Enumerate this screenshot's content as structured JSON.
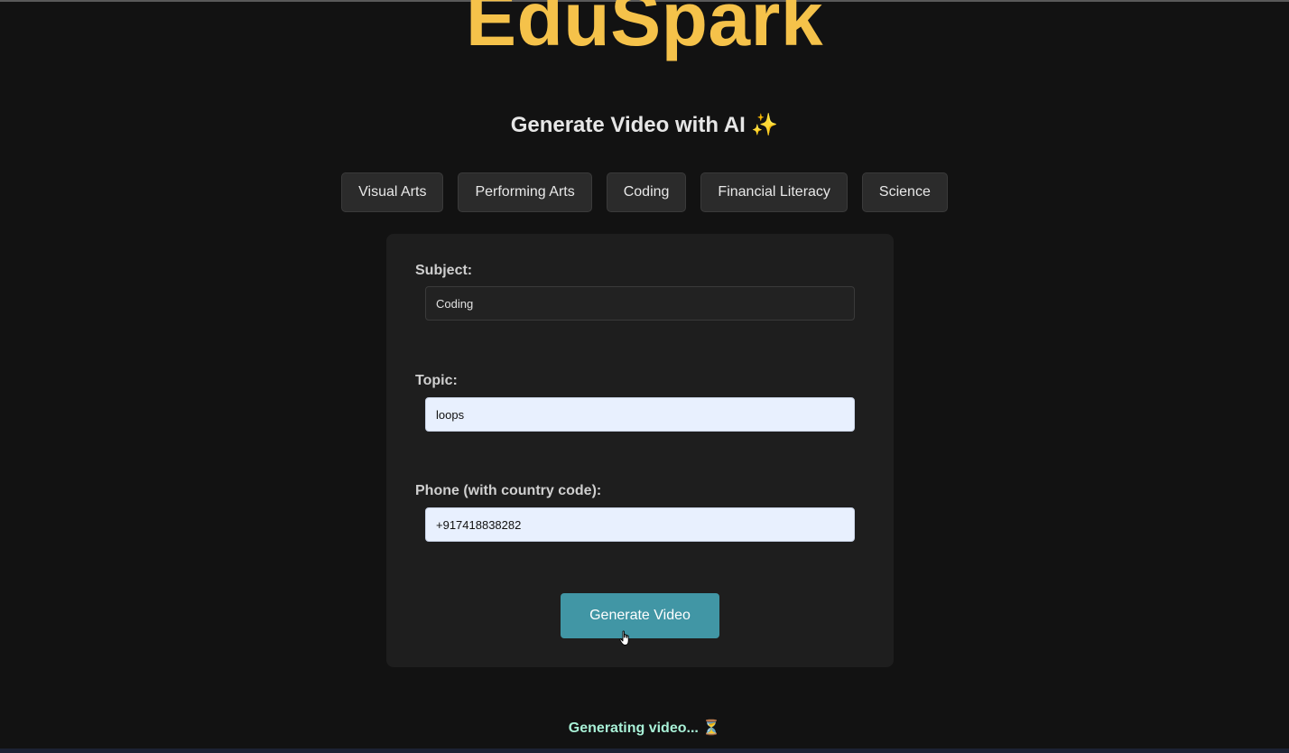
{
  "brand": "EduSpark",
  "heading": {
    "text": "Generate Video with AI",
    "emoji": "✨"
  },
  "subjects": [
    "Visual Arts",
    "Performing Arts",
    "Coding",
    "Financial Literacy",
    "Science"
  ],
  "form": {
    "subject": {
      "label": "Subject:",
      "value": "Coding"
    },
    "topic": {
      "label": "Topic:",
      "value": "loops"
    },
    "phone": {
      "label": "Phone (with country code):",
      "value": "+917418838282"
    },
    "submit_label": "Generate Video"
  },
  "status": {
    "text": "Generating video...",
    "icon": "⏳"
  },
  "colors": {
    "background": "#121212",
    "brand": "#f5c24a",
    "card": "#1e1e1e",
    "button": "#4196a5",
    "status": "#a8f0d6",
    "autofill": "#e8f0fe"
  }
}
